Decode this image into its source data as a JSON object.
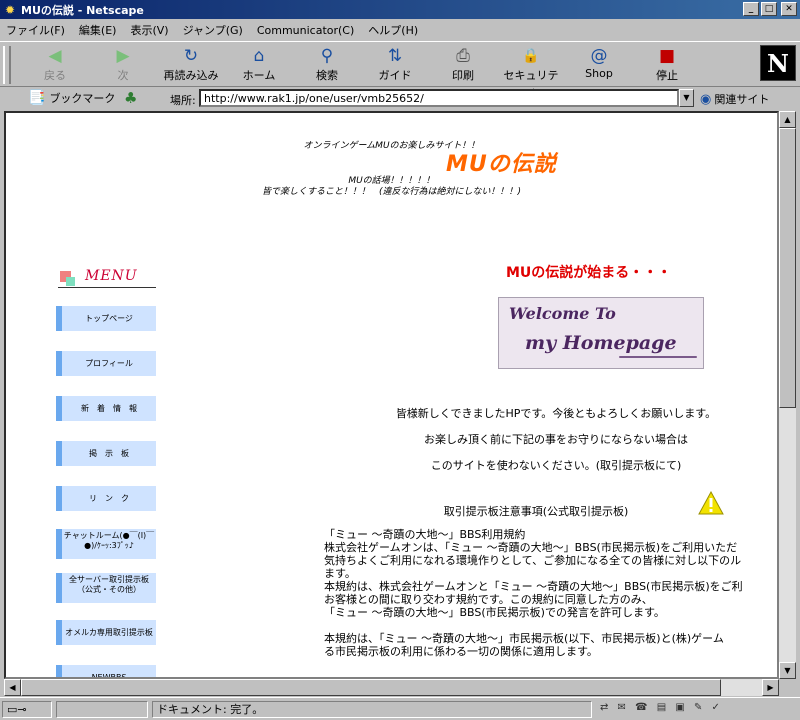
{
  "window": {
    "title": "MUの伝説 - Netscape"
  },
  "menubar": [
    "ファイル(F)",
    "編集(E)",
    "表示(V)",
    "ジャンプ(G)",
    "Communicator(C)",
    "ヘルプ(H)"
  ],
  "toolbar": {
    "buttons": [
      {
        "label": "戻る",
        "icon": "back-arrow-icon",
        "glyph": "◀"
      },
      {
        "label": "次",
        "icon": "forward-arrow-icon",
        "glyph": "▶"
      },
      {
        "label": "再読み込み",
        "icon": "reload-icon",
        "glyph": "↻"
      },
      {
        "label": "ホーム",
        "icon": "home-icon",
        "glyph": "⌂"
      },
      {
        "label": "検索",
        "icon": "search-icon",
        "glyph": "⚲"
      },
      {
        "label": "ガイド",
        "icon": "guide-icon",
        "glyph": "⇅"
      },
      {
        "label": "印刷",
        "icon": "print-icon",
        "glyph": "⎙"
      },
      {
        "label": "セキュリティ",
        "icon": "lock-icon",
        "glyph": "🔒"
      },
      {
        "label": "Shop",
        "icon": "shop-icon",
        "glyph": "@"
      },
      {
        "label": "停止",
        "icon": "stop-icon",
        "glyph": "■"
      }
    ],
    "logo": "N"
  },
  "locbar": {
    "bookmarks_label": "ブックマーク",
    "location_label": "場所:",
    "url": "http://www.rak1.jp/one/user/vmb25652/",
    "related_label": "関連サイト"
  },
  "page": {
    "tagline": "オンラインゲームMUのお楽しみサイト！！",
    "title": "MUの伝説",
    "sub1": "MUの話場！！！！！",
    "sub2": "皆で楽しくすること！！！　(違反な行為は絶対にしない！！！)",
    "menu_title": "MENU",
    "menu_items": [
      "トップページ",
      "プロフィール",
      "新　着　情　報",
      "掲　示　板",
      "リ　ン　ク",
      "チャットルーム(●￣(I)￣●)/ｹｰｯ:3ﾌﾟｯ♪",
      "全サーバー取引提示板（公式・その他）",
      "オメルカ専用取引提示板",
      "NEWBBS"
    ],
    "headline": "MUの伝説が始まる・・・",
    "banner_line1": "Welcome To",
    "banner_line2": "my Homepage",
    "intro1": "皆様新しくできましたHPです。今後ともよろしくお願いします。",
    "intro2": "お楽しみ頂く前に下記の事をお守りにならない場合は",
    "intro3": "このサイトを使わないください。(取引提示板にて)",
    "notice": "取引提示板注意事項(公式取引提示板)",
    "terms": [
      "「ミュー ～奇蹟の大地～」BBS利用規約",
      "株式会社ゲームオンは、「ミュー ～奇蹟の大地～」BBS(市民掲示板)をご利用いただ",
      "気持ちよくご利用になれる環境作りとして、ご参加になる全ての皆様に対し以下のル",
      "ます。",
      "本規約は、株式会社ゲームオンと「ミュー ～奇蹟の大地～」BBS(市民掲示板)をご利",
      "お客様との間に取り交わす規約です。この規約に同意した方のみ、",
      "「ミュー ～奇蹟の大地～」BBS(市民掲示板)での発言を許可します。",
      "",
      "本規約は、「ミュー ～奇蹟の大地～」市民掲示板(以下、市民掲示板)と(株)ゲーム",
      "る市民掲示板の利用に係わる一切の関係に適用します。"
    ]
  },
  "statusbar": {
    "text": "ドキュメント: 完了。"
  }
}
